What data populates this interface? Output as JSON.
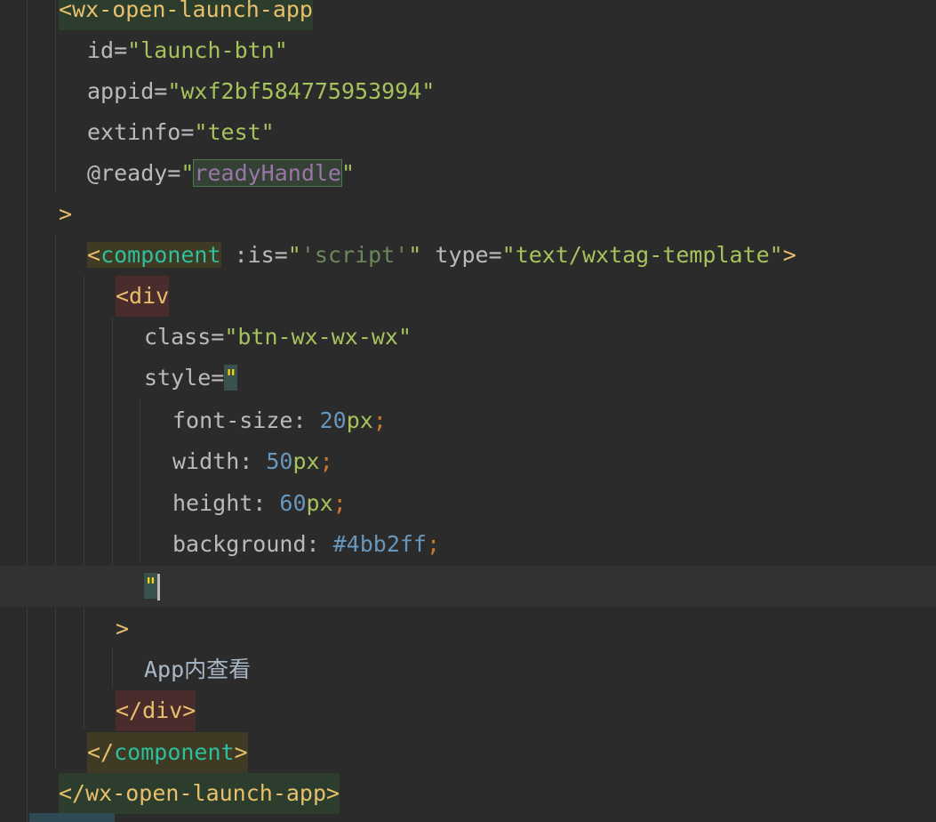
{
  "editor": {
    "lines": [
      {
        "open_tag": "<wx-open-launch-app"
      },
      {
        "attr": "id=",
        "value": "\"launch-btn\""
      },
      {
        "attr": "appid=",
        "value": "\"wxf2bf584775953994\""
      },
      {
        "attr": "extinfo=",
        "value": "\"test\""
      },
      {
        "attr": "@ready=",
        "q1": "\"",
        "handler": "readyHandle",
        "q2": "\""
      },
      {
        "close": ">"
      },
      {
        "lt": "<",
        "name": "component",
        "attr1": " :is=",
        "v1a": "\"",
        "v1b": "'script'",
        "v1c": "\"",
        "attr2": " type=",
        "v2": "\"text/wxtag-template\"",
        "gt": ">"
      },
      {
        "open_tag": "<div"
      },
      {
        "attr": "class=",
        "value": "\"btn-wx-wx-wx\""
      },
      {
        "attr": "style=",
        "quote": "\""
      },
      {
        "prop": "font-size: ",
        "num": "20",
        "unit": "px",
        "semi": ";"
      },
      {
        "prop": "width: ",
        "num": "50",
        "unit": "px",
        "semi": ";"
      },
      {
        "prop": "height: ",
        "num": "60",
        "unit": "px",
        "semi": ";"
      },
      {
        "prop": "background: ",
        "num": "#4bb2ff",
        "semi": ";"
      },
      {
        "quote": "\""
      },
      {
        "close": ">"
      },
      {
        "text": "App内查看"
      },
      {
        "close_tag": "</div>"
      },
      {
        "lt": "</",
        "name": "component",
        "gt": ">"
      },
      {
        "close_tag": "</wx-open-launch-app>"
      }
    ]
  },
  "colors": {
    "background": "#2b2b2b",
    "current_line": "#323232",
    "tag": "#e8bf6a",
    "component": "#2dbf9e",
    "string": "#6a8759",
    "number": "#6897bb",
    "semicolon": "#cc7832",
    "attribute": "#bababa"
  }
}
